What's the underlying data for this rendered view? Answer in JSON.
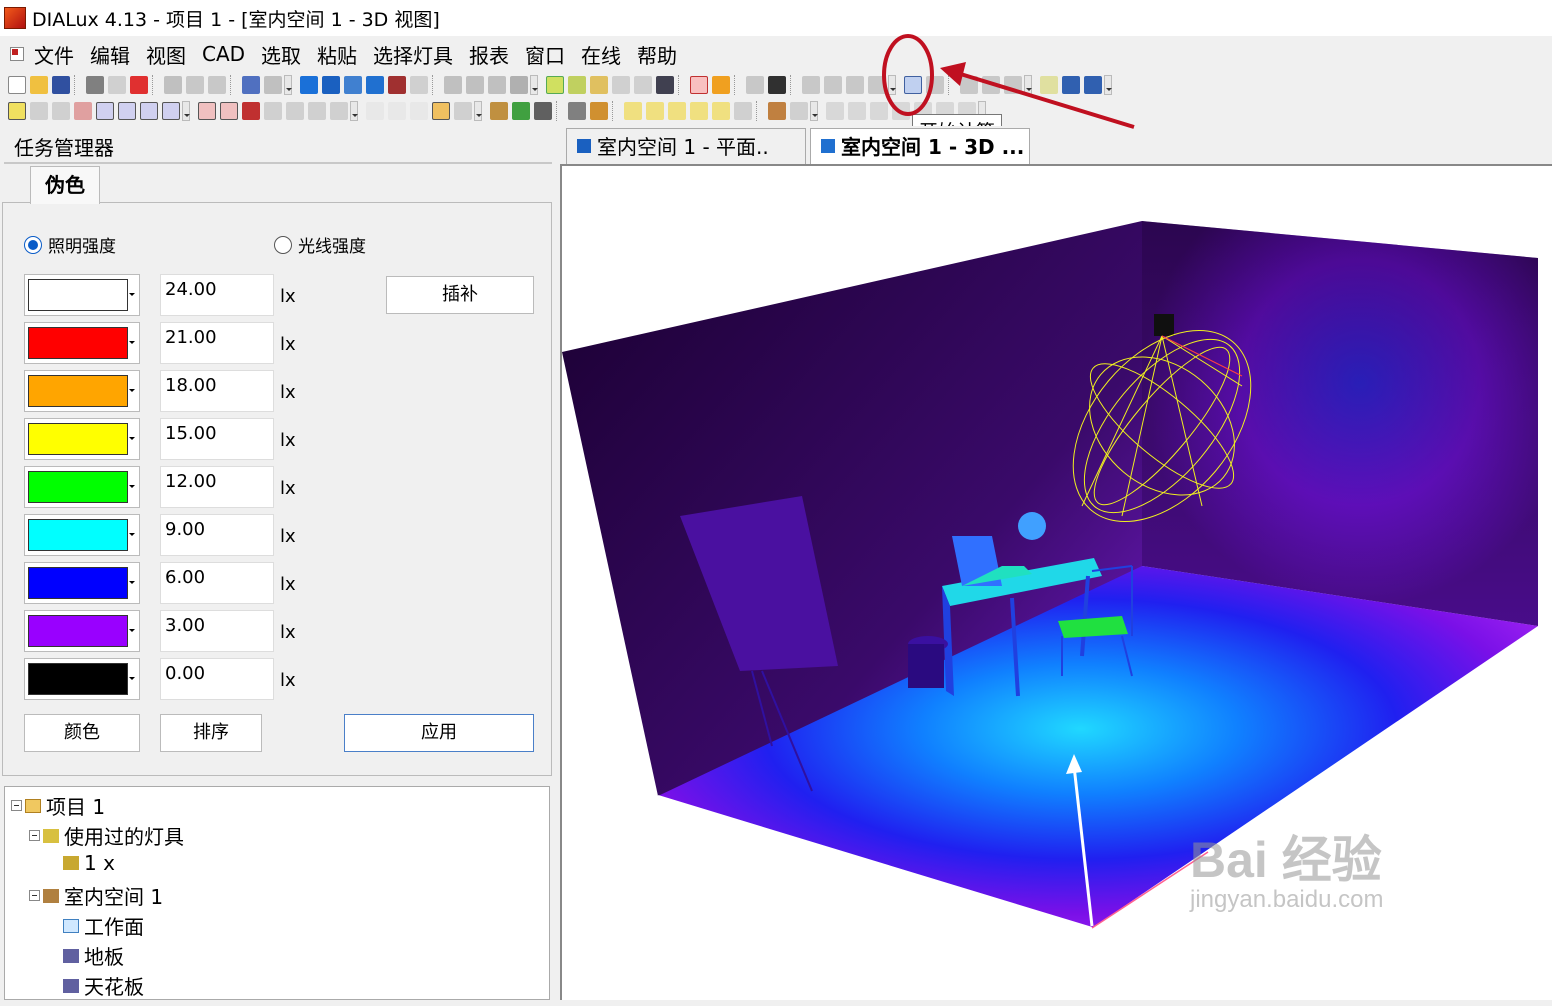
{
  "window": {
    "title": "DIALux 4.13 - 项目 1 - [室内空间 1 - 3D 视图]"
  },
  "menu": [
    "文件",
    "编辑",
    "视图",
    "CAD",
    "选取",
    "粘贴",
    "选择灯具",
    "报表",
    "窗口",
    "在线",
    "帮助"
  ],
  "tooltip": "开始计算",
  "task_manager": {
    "title": "任务管理器",
    "tab": "伪色"
  },
  "radios": {
    "illuminance": "照明强度",
    "luminance": "光线强度"
  },
  "scale": [
    {
      "value": "24.00",
      "unit": "lx",
      "color": "#ffffff"
    },
    {
      "value": "21.00",
      "unit": "lx",
      "color": "#ff0000"
    },
    {
      "value": "18.00",
      "unit": "lx",
      "color": "#ffa500"
    },
    {
      "value": "15.00",
      "unit": "lx",
      "color": "#ffff00"
    },
    {
      "value": "12.00",
      "unit": "lx",
      "color": "#00ff00"
    },
    {
      "value": "9.00",
      "unit": "lx",
      "color": "#00ffff"
    },
    {
      "value": "6.00",
      "unit": "lx",
      "color": "#0000ff"
    },
    {
      "value": "3.00",
      "unit": "lx",
      "color": "#9900ff"
    },
    {
      "value": "0.00",
      "unit": "lx",
      "color": "#000000"
    }
  ],
  "buttons": {
    "interpolate": "插补",
    "color": "颜色",
    "sort": "排序",
    "apply": "应用"
  },
  "tree": {
    "project": "项目 1",
    "used_luminaires": "使用过的灯具",
    "luminaire": "1 x",
    "room": "室内空间 1",
    "workplane": "工作面",
    "floor": "地板",
    "ceiling": "天花板"
  },
  "tabs": {
    "plan": "室内空间 1 - 平面..",
    "view3d": "室内空间 1 - 3D ..."
  },
  "watermark": {
    "brand": "Bai 经验",
    "url": "jingyan.baidu.com"
  }
}
